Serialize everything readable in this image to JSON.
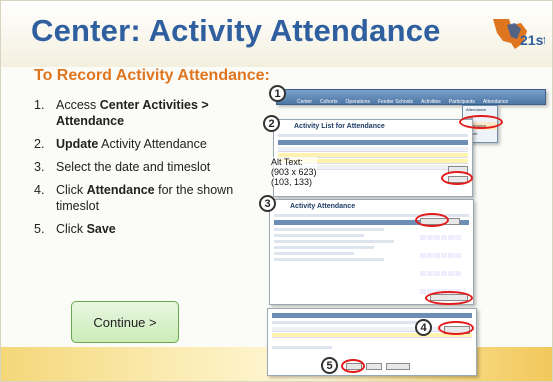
{
  "slide": {
    "title": "Center: Activity Attendance",
    "logo_text": "21st",
    "subtitle": "To Record Activity Attendance:",
    "steps": [
      {
        "num": "1.",
        "parts": [
          "Access ",
          "Center Activities > Attendance",
          ""
        ]
      },
      {
        "num": "2.",
        "parts": [
          "",
          "Update",
          " Activity Attendance"
        ]
      },
      {
        "num": "3.",
        "parts": [
          "Select the date and timeslot",
          "",
          ""
        ]
      },
      {
        "num": "4.",
        "parts": [
          "Click ",
          "Attendance",
          " for the shown timeslot"
        ]
      },
      {
        "num": "5.",
        "parts": [
          "Click ",
          "Save",
          ""
        ]
      }
    ],
    "continue_label": "Continue >"
  },
  "screenshot_callouts": {
    "markers": [
      "1",
      "2",
      "3",
      "4",
      "5"
    ],
    "alt_text": "Alt Text:",
    "alt_dims": "(903 x 623)",
    "alt_dims2": "(103, 133)"
  },
  "menu": {
    "items": [
      "Center",
      "Cohorts",
      "Operations",
      "Feeder Schools",
      "Activities",
      "Participants",
      "Attendance"
    ],
    "dropdown": [
      "Attendance",
      "Edit",
      "Attendance",
      "Import",
      "Bulk Entry"
    ]
  },
  "screens": {
    "list_title": "Activity List for Attendance",
    "attendance_title": "Activity Attendance"
  },
  "colors": {
    "title": "#2f5f9f",
    "subtitle": "#e0751f",
    "marker_ring": "#e21b1b",
    "button": "#cbecb8"
  }
}
